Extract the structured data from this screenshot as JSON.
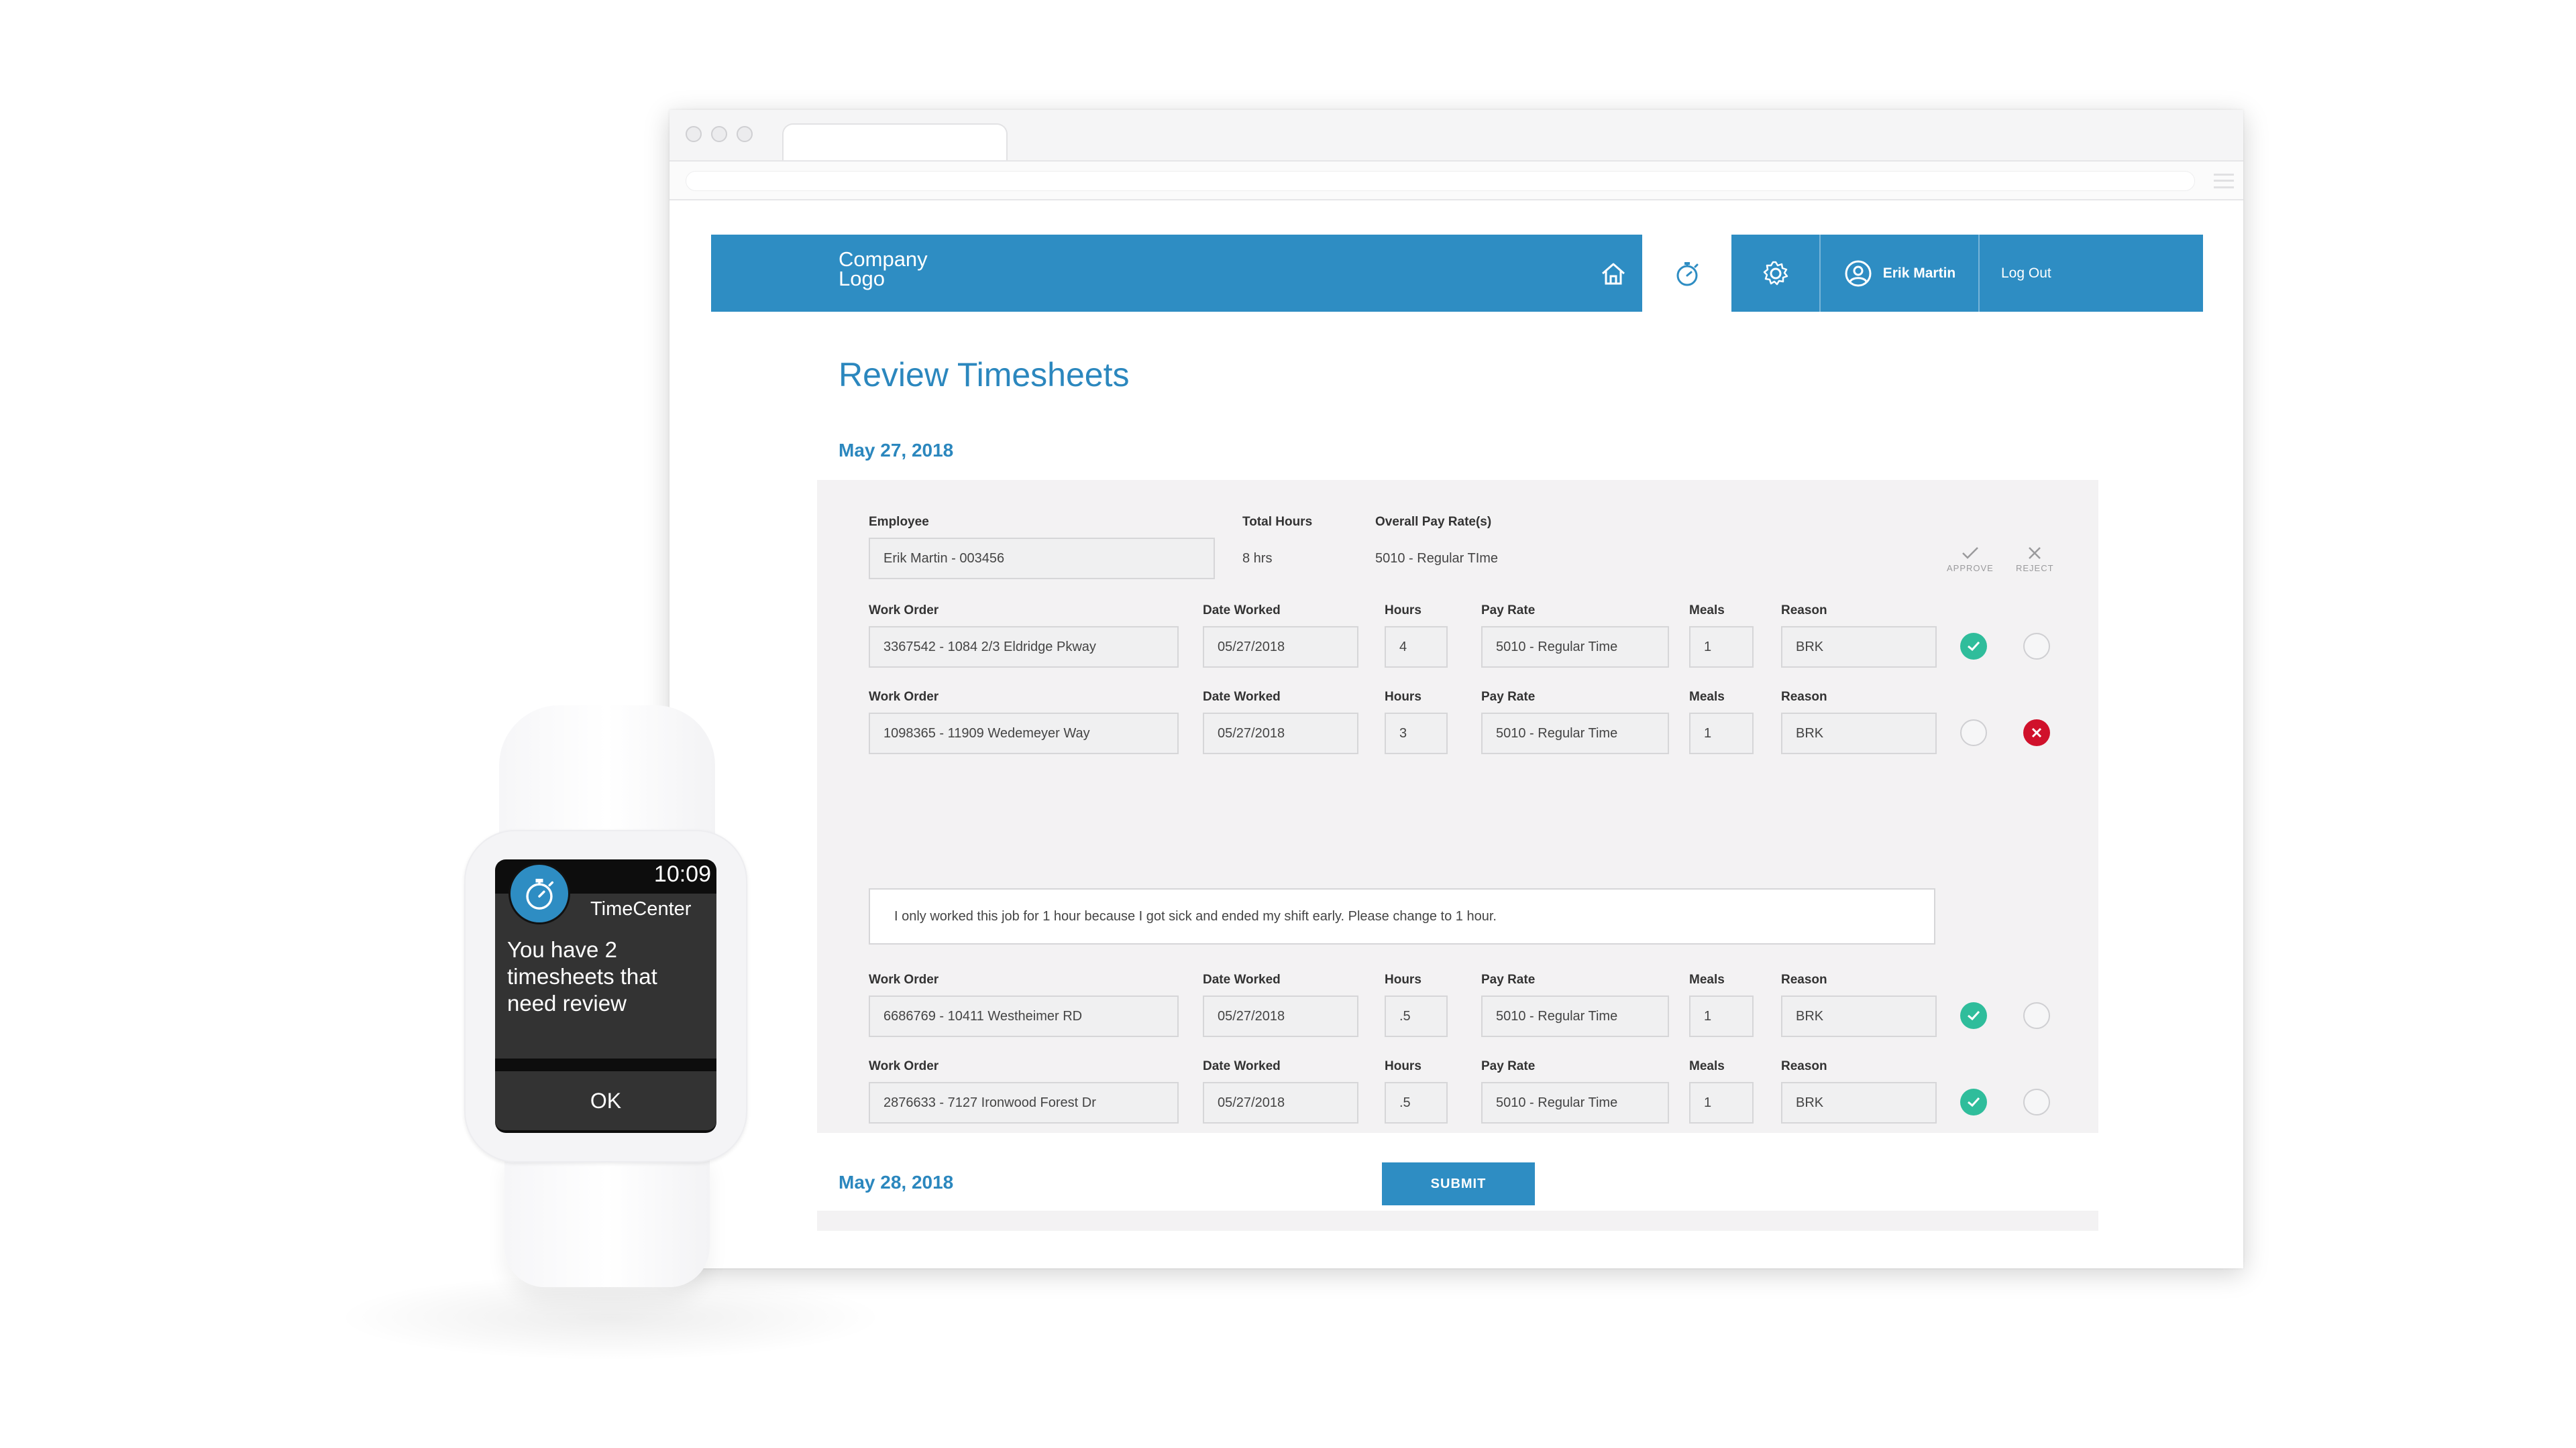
{
  "header": {
    "logo": "Company\nLogo",
    "user_name": "Erik Martin",
    "logout": "Log Out"
  },
  "page": {
    "title": "Review Timesheets",
    "date1": "May 27, 2018",
    "date2": "May 28, 2018"
  },
  "summary": {
    "employee_label": "Employee",
    "employee_value": "Erik Martin - 003456",
    "total_hours_label": "Total Hours",
    "total_hours_value": "8 hrs",
    "pay_rate_label": "Overall Pay Rate(s)",
    "pay_rate_value": "5010 - Regular TIme",
    "approve_label": "APPROVE",
    "reject_label": "REJECT"
  },
  "columns": {
    "work_order": "Work Order",
    "date_worked": "Date Worked",
    "hours": "Hours",
    "pay_rate": "Pay Rate",
    "meals": "Meals",
    "reason": "Reason"
  },
  "rows": [
    {
      "work_order": "3367542 - 1084 2/3 Eldridge Pkway",
      "date": "05/27/2018",
      "hours": "4",
      "pay_rate": "5010 - Regular Time",
      "meals": "1",
      "reason": "BRK",
      "status": "approved"
    },
    {
      "work_order": "1098365 - 11909 Wedemeyer Way",
      "date": "05/27/2018",
      "hours": "3",
      "pay_rate": "5010 - Regular Time",
      "meals": "1",
      "reason": "BRK",
      "status": "rejected"
    },
    {
      "work_order": "6686769 - 10411 Westheimer RD",
      "date": "05/27/2018",
      "hours": ".5",
      "pay_rate": "5010 - Regular Time",
      "meals": "1",
      "reason": "BRK",
      "status": "approved"
    },
    {
      "work_order": "2876633 - 7127 Ironwood Forest Dr",
      "date": "05/27/2018",
      "hours": ".5",
      "pay_rate": "5010 - Regular Time",
      "meals": "1",
      "reason": "BRK",
      "status": "approved"
    }
  ],
  "comment": "I only worked this job for 1 hour because I got sick and ended my shift early. Please change to 1 hour.",
  "submit_label": "SUBMIT",
  "watch": {
    "time": "10:09",
    "app_name": "TimeCenter",
    "message": "You have 2 timesheets that need review",
    "ok_label": "OK"
  },
  "colors": {
    "brand_blue": "#2e8dc3",
    "approve_green": "#2fbd9b",
    "reject_red": "#d0112b"
  },
  "icons": [
    "home-icon",
    "stopwatch-icon",
    "gear-icon",
    "user-icon",
    "check-icon",
    "x-icon"
  ]
}
